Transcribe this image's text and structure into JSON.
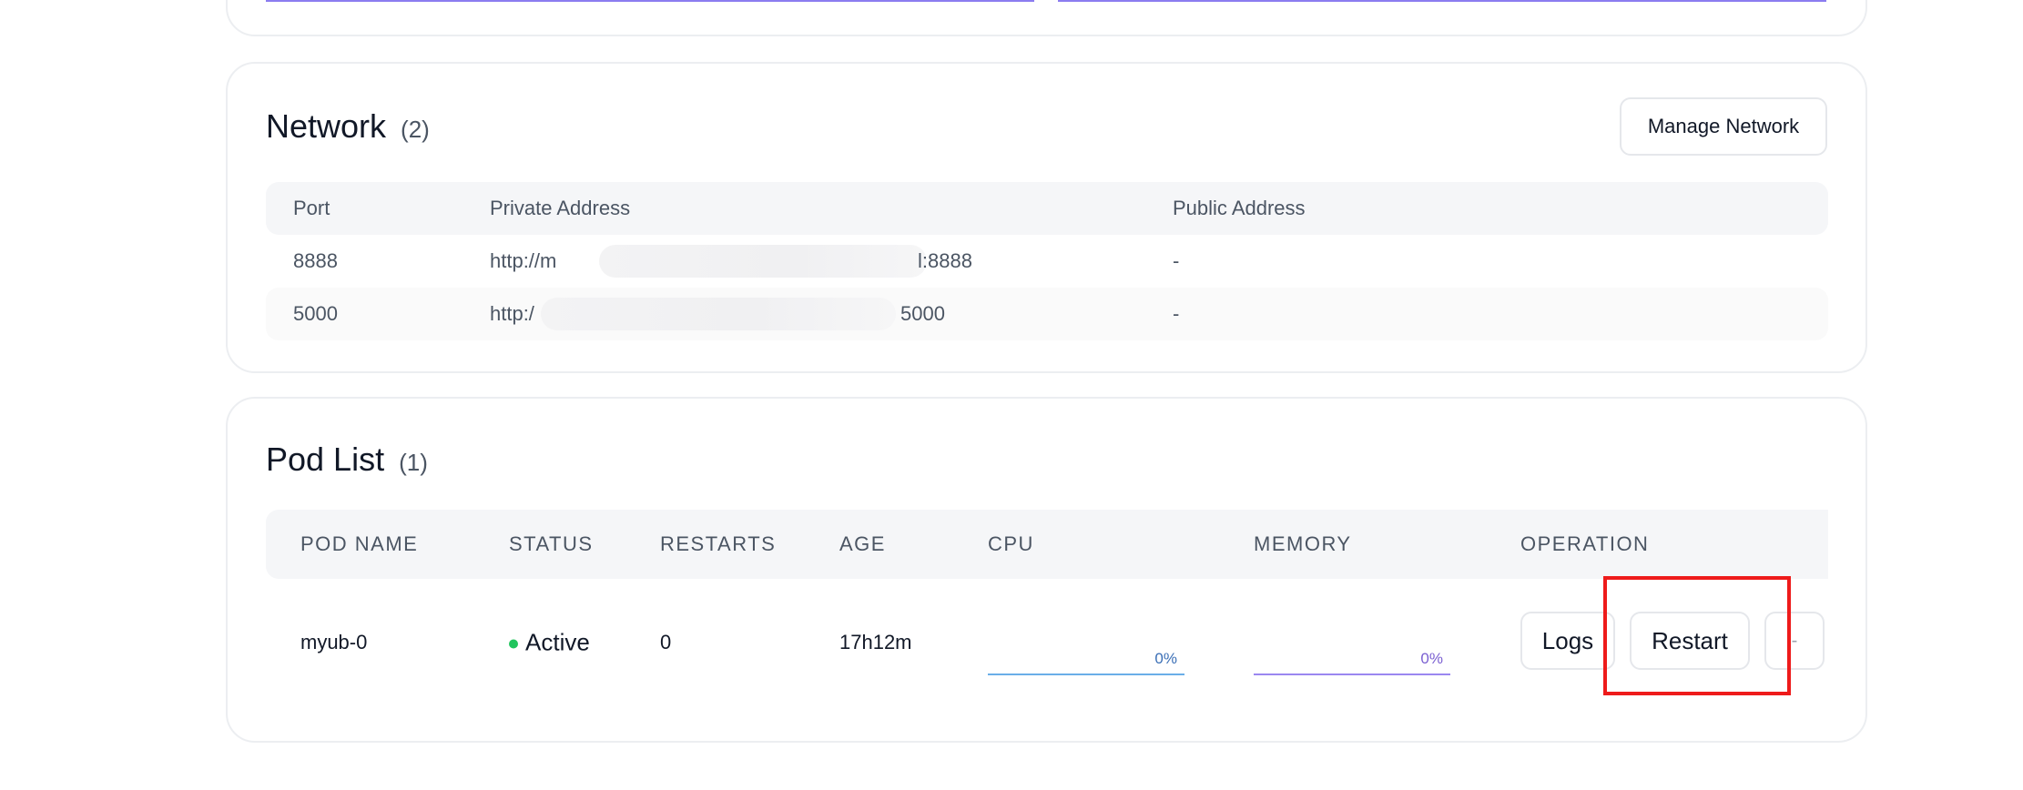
{
  "network": {
    "title": "Network",
    "count": "(2)",
    "manage_label": "Manage Network",
    "columns": {
      "port": "Port",
      "private": "Private Address",
      "public": "Public Address"
    },
    "rows": [
      {
        "port": "8888",
        "private_start": "http://m",
        "private_end": "l:8888",
        "public": "-"
      },
      {
        "port": "5000",
        "private_start": "http:/",
        "private_end": "5000",
        "public": "-"
      }
    ]
  },
  "pods": {
    "title": "Pod List",
    "count": "(1)",
    "columns": {
      "name": "POD NAME",
      "status": "STATUS",
      "restarts": "RESTARTS",
      "age": "AGE",
      "cpu": "CPU",
      "memory": "MEMORY",
      "operation": "OPERATION"
    },
    "rows": [
      {
        "name": "myub-0",
        "status": "Active",
        "restarts": "0",
        "age": "17h12m",
        "cpu": "0%",
        "memory": "0%",
        "cpu_fraction": 0,
        "memory_fraction": 0
      }
    ],
    "actions": {
      "logs": "Logs",
      "restart": "Restart",
      "more": "-"
    }
  },
  "colors": {
    "accent_bar": "#8b7cf0",
    "status_active": "#22c55e",
    "cpu_meter": "#6aaee8",
    "memory_meter": "#9b87f0",
    "highlight": "#ee1b1b"
  }
}
